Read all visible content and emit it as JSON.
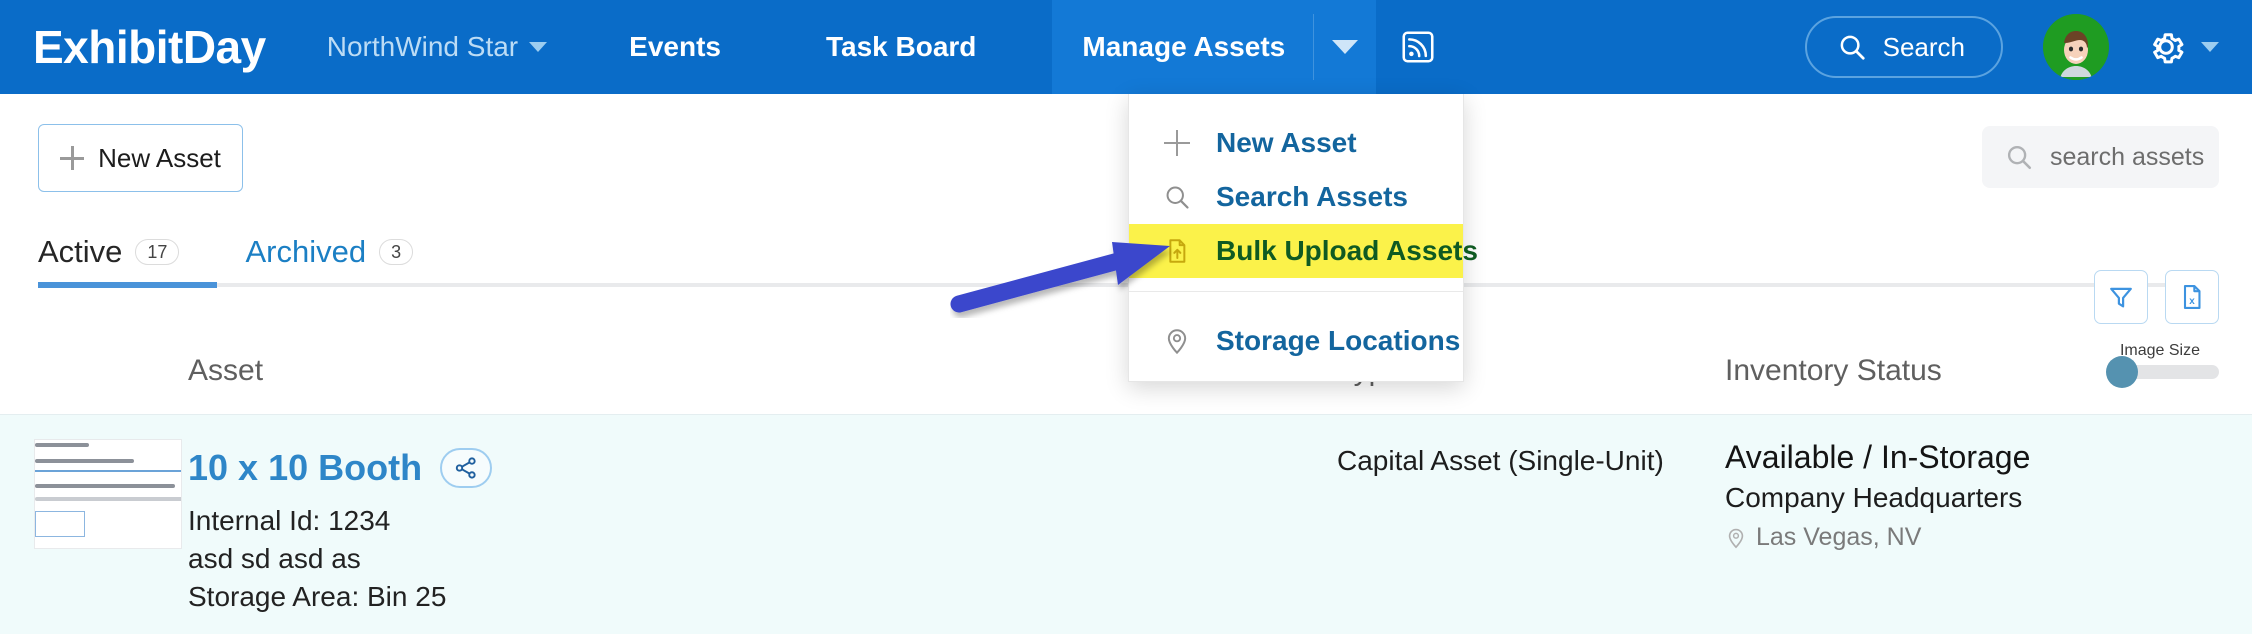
{
  "topnav": {
    "brand": "ExhibitDay",
    "org_name": "NorthWind Star",
    "links": [
      {
        "label": "Events",
        "name": "nav-events"
      },
      {
        "label": "Task Board",
        "name": "nav-task-board"
      }
    ],
    "active_link": "Manage Assets",
    "search_label": "Search",
    "icons": {
      "org_caret": "chevron-down-icon",
      "manage_caret": "chevron-down-icon",
      "rss": "rss-feed-icon",
      "search": "search-icon",
      "avatar": "user-avatar",
      "gear": "gear-icon",
      "gear_caret": "chevron-down-icon"
    },
    "colors": {
      "nav_bg": "#0a6cc8",
      "nav_active_bg": "#1379d6",
      "org_text": "#bcdcf5"
    }
  },
  "menu": {
    "items": [
      {
        "label": "New Asset",
        "icon": "plus-icon",
        "highlighted": false
      },
      {
        "label": "Search Assets",
        "icon": "search-icon",
        "highlighted": false
      },
      {
        "label": "Bulk Upload Assets",
        "icon": "file-upload-icon",
        "highlighted": true
      },
      {
        "label": "Storage Locations",
        "icon": "map-pin-icon",
        "highlighted": false
      }
    ],
    "highlight_color": "#fbf24a",
    "highlight_text_color": "#0f5a22",
    "link_color": "#13659e"
  },
  "annotation": {
    "type": "arrow",
    "color": "#3b47cc",
    "points_to": "Bulk Upload Assets"
  },
  "toolbar": {
    "new_asset_label": "New Asset",
    "new_asset_icon": "plus-icon",
    "search_assets_placeholder": "search assets",
    "search_assets_icon": "search-icon",
    "filter_icon": "filter-funnel-icon",
    "export_icon": "excel-export-icon"
  },
  "tabs": [
    {
      "label": "Active",
      "count": "17",
      "active": true
    },
    {
      "label": "Archived",
      "count": "3",
      "active": false
    }
  ],
  "image_size": {
    "label": "Image Size",
    "value": 0
  },
  "table": {
    "columns": [
      "Asset",
      "Type",
      "Inventory Status"
    ],
    "rows": [
      {
        "thumbnail": "asset-form-screenshot",
        "name": "10 x 10 Booth",
        "share_icon": "share-icon",
        "internal_id": "Internal Id: 1234",
        "description": "asd sd asd as",
        "storage_area": "Storage Area: Bin 25",
        "type": "Capital Asset (Single-Unit)",
        "inventory_status": "Available / In-Storage",
        "location_name": "Company Headquarters",
        "location_city": "Las Vegas, NV",
        "location_icon": "map-pin-icon"
      }
    ]
  }
}
